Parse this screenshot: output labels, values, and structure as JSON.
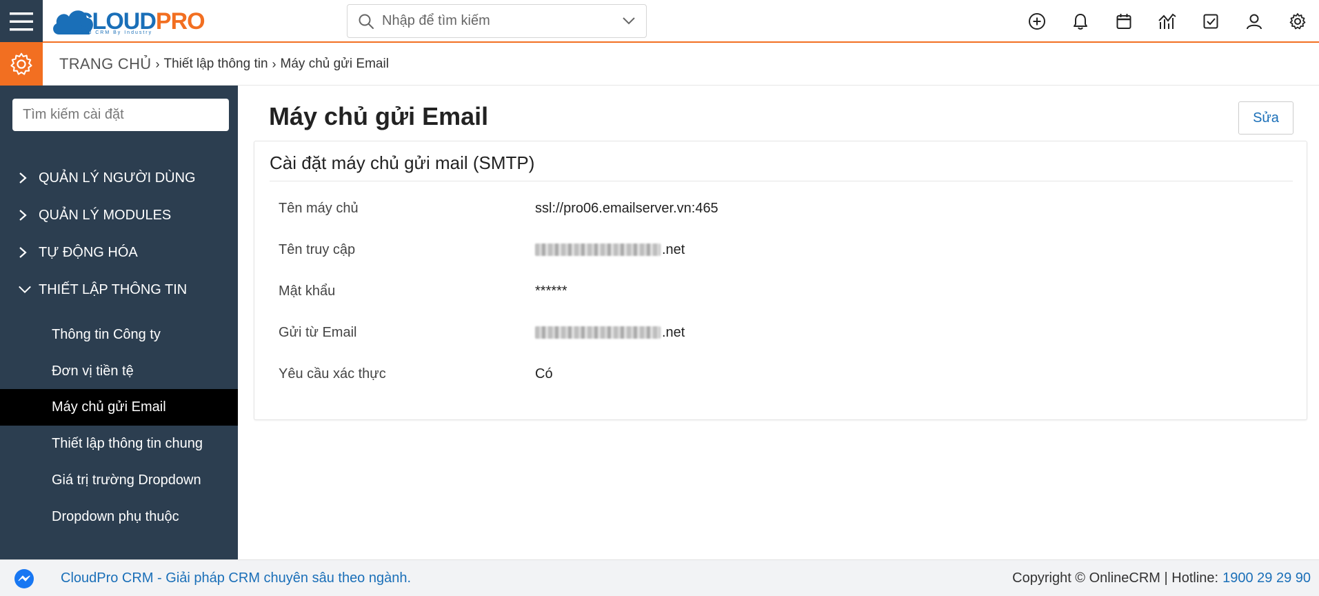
{
  "brand": {
    "logo_main": "CLOUD",
    "logo_accent": "PRO",
    "logo_tagline": "Cloud CRM By Industry"
  },
  "search": {
    "placeholder": "Nhập để tìm kiếm"
  },
  "top_icons": [
    "plus-circle-icon",
    "bell-icon",
    "calendar-icon",
    "chart-icon",
    "checkbox-icon",
    "user-icon",
    "gear-icon"
  ],
  "breadcrumb": {
    "home": "TRANG CHỦ",
    "level1": "Thiết lập thông tin",
    "level2": "Máy chủ gửi Email"
  },
  "sidebar": {
    "search_placeholder": "Tìm kiếm cài đặt",
    "groups": [
      {
        "label": "QUẢN LÝ NGƯỜI DÙNG",
        "expanded": false
      },
      {
        "label": "QUẢN LÝ MODULES",
        "expanded": false
      },
      {
        "label": "TỰ ĐỘNG HÓA",
        "expanded": false
      },
      {
        "label": "THIẾT LẬP THÔNG TIN",
        "expanded": true
      }
    ],
    "items": [
      {
        "label": "Thông tin Công ty"
      },
      {
        "label": "Đơn vị tiền tệ"
      },
      {
        "label": "Máy chủ gửi Email",
        "active": true
      },
      {
        "label": "Thiết lập thông tin chung"
      },
      {
        "label": "Giá trị trường Dropdown"
      },
      {
        "label": "Dropdown phụ thuộc"
      }
    ]
  },
  "main": {
    "title": "Máy chủ gửi Email",
    "edit_label": "Sửa",
    "card_title": "Cài đặt máy chủ gửi mail (SMTP)",
    "fields": [
      {
        "label": "Tên máy chủ",
        "value": "ssl://pro06.emailserver.vn:465"
      },
      {
        "label": "Tên truy cập",
        "value": ".net"
      },
      {
        "label": "Mật khẩu",
        "value": "******"
      },
      {
        "label": "Gửi từ Email",
        "value": ".net"
      },
      {
        "label": "Yêu cầu xác thực",
        "value": "Có"
      }
    ]
  },
  "footer": {
    "tagline": "CloudPro CRM - Giải pháp CRM chuyên sâu theo ngành.",
    "copyright": "Copyright © OnlineCRM | Hotline:",
    "hotline": "1900 29 29 90"
  },
  "colors": {
    "accent": "#f26f21",
    "sidebar": "#2c3e50",
    "link": "#1a6fb8",
    "active_item": "#000000"
  }
}
